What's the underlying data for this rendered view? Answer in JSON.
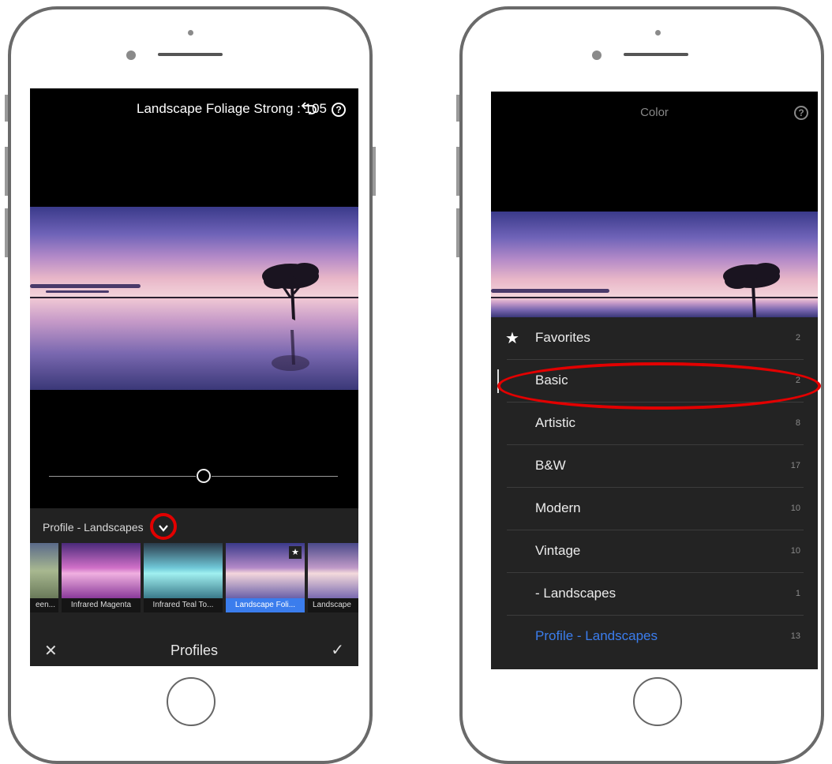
{
  "left_screen": {
    "header": {
      "title": "Landscape Foliage Strong : 105",
      "undo_icon": "undo-icon",
      "help_icon": "?"
    },
    "slider": {
      "value": 0.6
    },
    "profile_bar": {
      "label": "Profile - Landscapes",
      "dropdown_icon": "chevron-down-icon"
    },
    "thumbnails": [
      {
        "label": "een..."
      },
      {
        "label": "Infrared Magenta"
      },
      {
        "label": "Infrared Teal To..."
      },
      {
        "label": "Landscape Foli...",
        "selected": true,
        "favorite_icon": "★"
      },
      {
        "label": "Landscape"
      }
    ],
    "bottom_bar": {
      "close_icon": "✕",
      "title": "Profiles",
      "confirm_icon": "✓"
    }
  },
  "right_screen": {
    "header": {
      "title": "Color",
      "help_icon": "?"
    },
    "menu": [
      {
        "label": "Favorites",
        "count": "2",
        "icon": "★"
      },
      {
        "label": "Basic",
        "count": "2"
      },
      {
        "label": "Artistic",
        "count": "8"
      },
      {
        "label": "B&W",
        "count": "17"
      },
      {
        "label": "Modern",
        "count": "10"
      },
      {
        "label": "Vintage",
        "count": "10"
      },
      {
        "label": " - Landscapes",
        "count": "1"
      },
      {
        "label": "Profile - Landscapes",
        "count": "13",
        "active": true
      }
    ]
  },
  "colors": {
    "accent_blue": "#3b7ded",
    "highlight_red": "#e20000",
    "screen_bg": "#000000",
    "panel_bg": "#232323"
  }
}
